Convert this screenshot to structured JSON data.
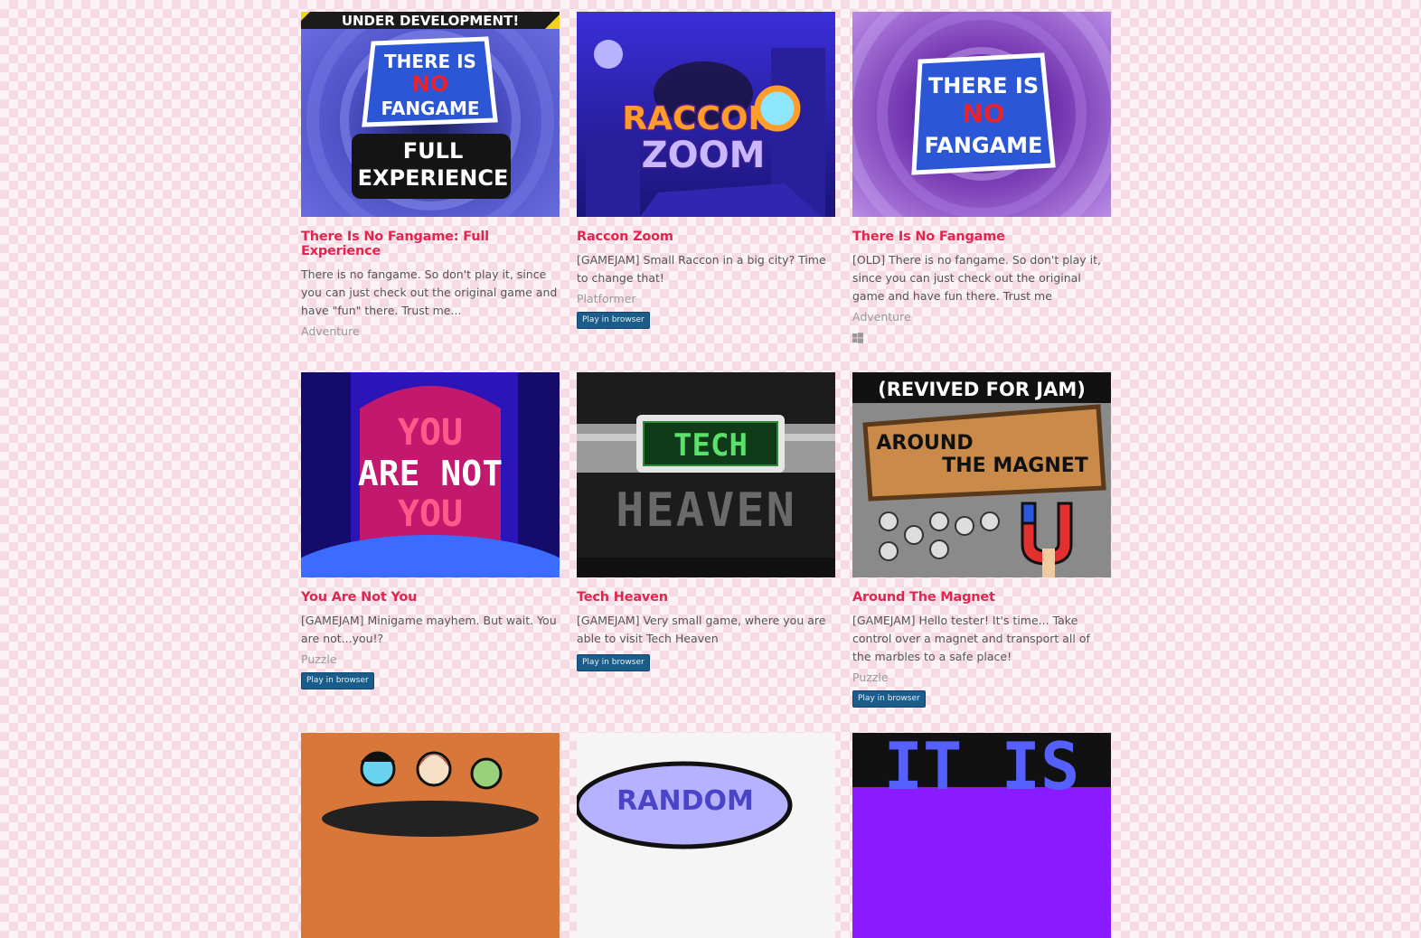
{
  "colors": {
    "title": "#e0264e",
    "badge": "#1a5d8a",
    "text": "#555555",
    "genre": "#999999"
  },
  "games": [
    {
      "title": "There Is No Fangame: Full Experience",
      "description": "There is no fangame. So don't play it, since you can just check out the original game and have \"fun\" there. Trust me...",
      "genre": "Adventure",
      "banner": "UNDER DEVELOPMENT!",
      "art": [
        "THERE IS",
        "NO",
        "FANGAME",
        "FULL",
        "EXPERIENCE"
      ]
    },
    {
      "title": "Raccon Zoom",
      "description": "[GAMEJAM] Small Raccon in a big city? Time to change that!",
      "genre": "Platformer",
      "badge": "Play in browser",
      "art": [
        "RACCON",
        "ZOOM"
      ]
    },
    {
      "title": "There Is No Fangame",
      "description": "[OLD] There is no fangame. So don't play it, since you can just check out the original game and have fun there. Trust me",
      "genre": "Adventure",
      "platform_icon": "windows-icon",
      "art": [
        "THERE IS",
        "NO",
        "FANGAME"
      ]
    },
    {
      "title": "You Are Not You",
      "description": "[GAMEJAM] Minigame mayhem. But wait. You are not...you!?",
      "genre": "Puzzle",
      "badge": "Play in browser",
      "art": [
        "YOU",
        "ARE NOT",
        "YOU"
      ]
    },
    {
      "title": "Tech Heaven",
      "description": "[GAMEJAM] Very small game, where you are able to visit Tech Heaven",
      "badge": "Play in browser",
      "art": [
        "TECH",
        "HEAVEN"
      ]
    },
    {
      "title": "Around The Magnet",
      "description": "[GAMEJAM] Hello tester! It's time... Take control over a magnet and transport all of the marbles to a safe place!",
      "genre": "Puzzle",
      "badge": "Play in browser",
      "art": [
        "(REVIVED FOR JAM)",
        "AROUND",
        "THE MAGNET"
      ]
    },
    {
      "art": []
    },
    {
      "art": [
        "RANDOM"
      ]
    },
    {
      "art": [
        "IT IS"
      ]
    }
  ]
}
